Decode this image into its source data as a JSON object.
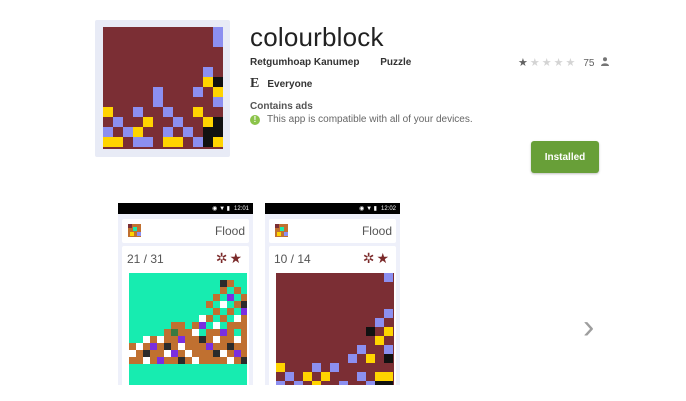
{
  "app": {
    "title": "colourblock",
    "developer": "Retgumhoap Kanumep",
    "category": "Puzzle",
    "rating_count": "75",
    "content_rating": "Everyone",
    "ads_notice": "Contains ads",
    "compat_notice": "This app is compatible with all of your devices.",
    "install_label": "Installed",
    "esrb_letter": "E"
  },
  "rating": {
    "stars_filled": 1,
    "stars_total": 5
  },
  "colors": {
    "maroon": "#7b2e34",
    "lavender": "#8c8ff0",
    "gold": "#ffd400",
    "black": "#111111",
    "green_button": "#689f38",
    "teal": "#17ecb0"
  },
  "icons": {
    "person": "person-icon",
    "info": "info-icon",
    "gear": "gear-icon",
    "star": "star-icon",
    "next": "chevron-right-icon"
  },
  "screenshots": [
    {
      "mode": "Flood",
      "score": "21 / 31",
      "time": "12:01"
    },
    {
      "mode": "Flood",
      "score": "10 / 14",
      "time": "12:02"
    }
  ]
}
